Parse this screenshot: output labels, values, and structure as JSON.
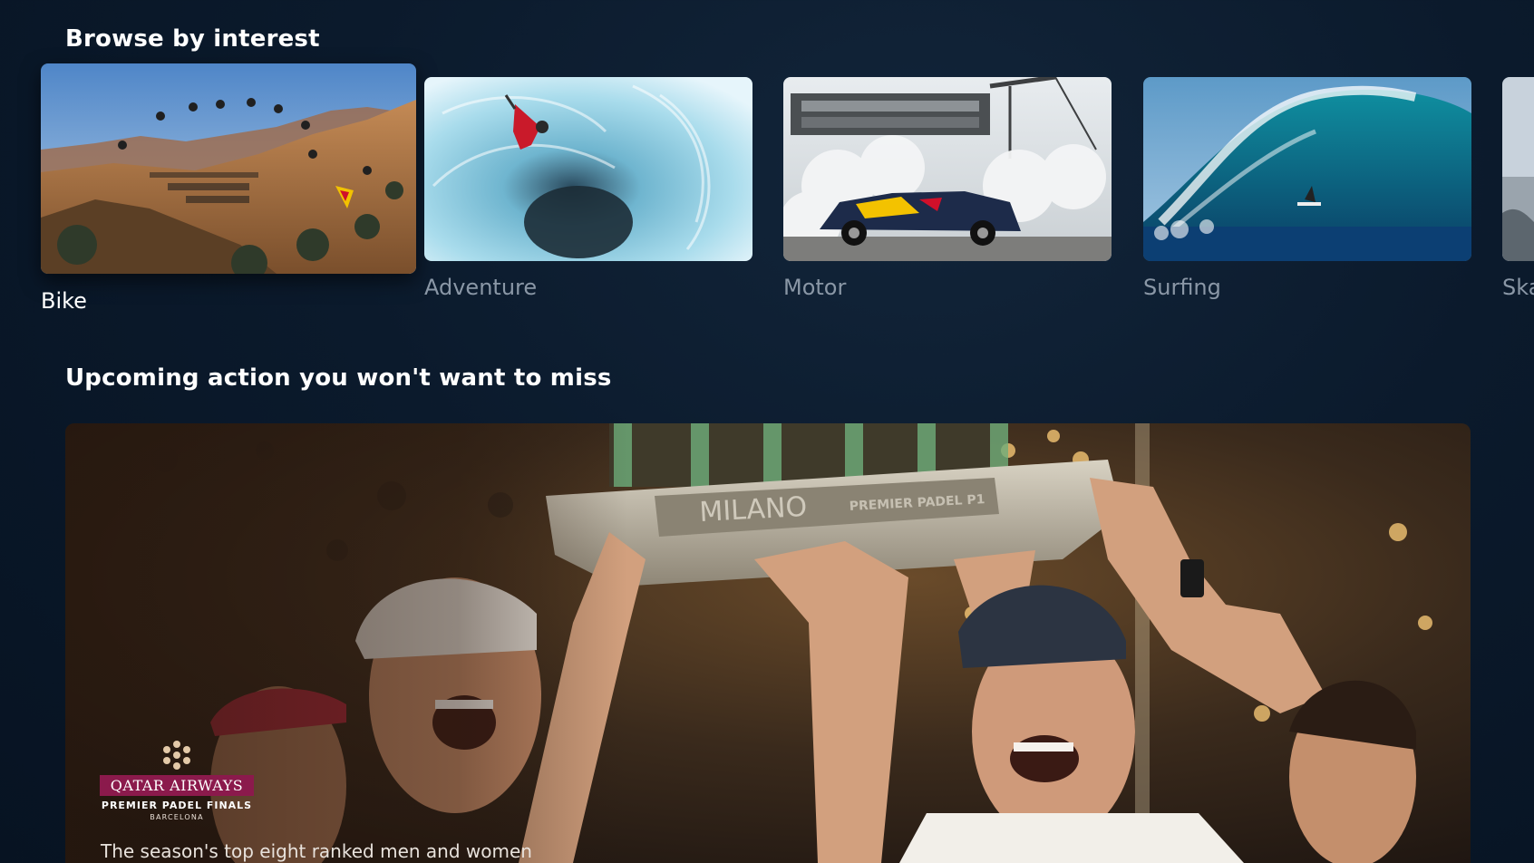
{
  "browse": {
    "title": "Browse by interest",
    "tiles": [
      {
        "label": "Bike",
        "focused": true,
        "image": "downhill-mountain-bike-jumps-canyon"
      },
      {
        "label": "Adventure",
        "focused": false,
        "image": "ice-cave-climber"
      },
      {
        "label": "Motor",
        "focused": false,
        "image": "drift-car-smoke-industrial"
      },
      {
        "label": "Surfing",
        "focused": false,
        "image": "big-wave-surfer-barrel"
      },
      {
        "label": "Ska",
        "focused": false,
        "image": "partial-next-tile"
      }
    ]
  },
  "upcoming": {
    "title": "Upcoming action you won't want to miss",
    "hero": {
      "image": "padel-players-lifting-trophy",
      "trophy_text": "MILANO",
      "trophy_subtext": "PREMIER PADEL P1",
      "logo": {
        "mark_icon": "qatar-airways-oryx-star-icon",
        "sponsor": "QATAR AIRWAYS",
        "event": "PREMIER PADEL FINALS",
        "city": "BARCELONA"
      },
      "description": "The season's top eight ranked men and women"
    }
  },
  "colors": {
    "background": "#0b1a2c",
    "label_inactive": "#8a97a6",
    "label_active": "#ffffff",
    "sponsor_maroon": "#8b1a4c"
  }
}
